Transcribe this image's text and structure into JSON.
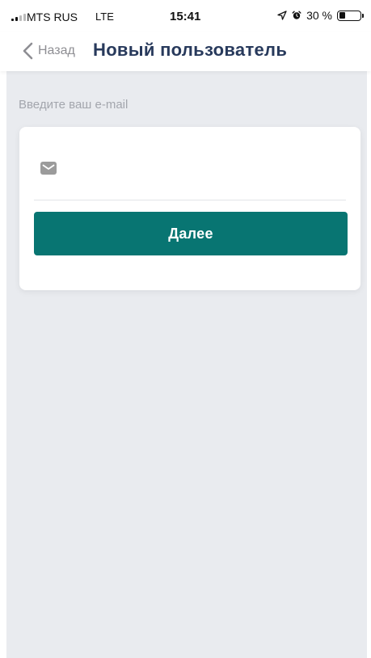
{
  "status_bar": {
    "carrier": "MTS RUS",
    "network": "LTE",
    "time": "15:41",
    "battery_percent": "30 %",
    "battery_level": 0.3,
    "icons": [
      "signal-icon",
      "location-arrow-icon",
      "alarm-icon",
      "battery-icon"
    ]
  },
  "nav": {
    "back_label": "Назад",
    "title": "Новый пользователь",
    "back_icon": "chevron-left-icon"
  },
  "form": {
    "prompt": "Введите ваш e-mail",
    "email_value": "",
    "email_icon": "envelope-icon",
    "next_label": "Далее"
  },
  "colors": {
    "accent": "#087572",
    "title": "#283a5c",
    "background": "#e9ebef",
    "back_text": "#8e8e93",
    "prompt_text": "#a3a6ad"
  }
}
